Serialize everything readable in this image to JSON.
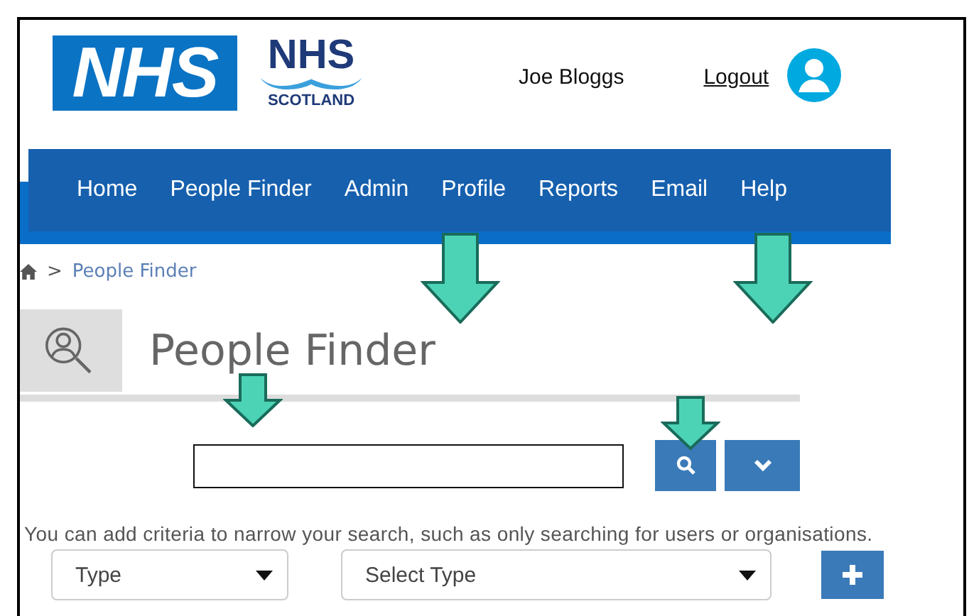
{
  "logos": [
    {
      "kind": "nhs",
      "text": "NHS"
    },
    {
      "kind": "nhs_scotland",
      "text": "NHS",
      "subtext": "SCOTLAND"
    }
  ],
  "user": {
    "name": "Joe Bloggs",
    "logout": "Logout"
  },
  "nav": [
    {
      "label": "Home"
    },
    {
      "label": "People Finder"
    },
    {
      "label": "Admin"
    },
    {
      "label": "Profile"
    },
    {
      "label": "Reports"
    },
    {
      "label": "Email"
    },
    {
      "label": "Help"
    }
  ],
  "breadcrumb": {
    "separator": ">",
    "current": "People Finder"
  },
  "page_title": "People Finder",
  "hint": "You can add criteria to narrow your search, such as only searching for users or organisations.",
  "filters": [
    {
      "value": "Type"
    },
    {
      "value": "Select Type"
    }
  ]
}
